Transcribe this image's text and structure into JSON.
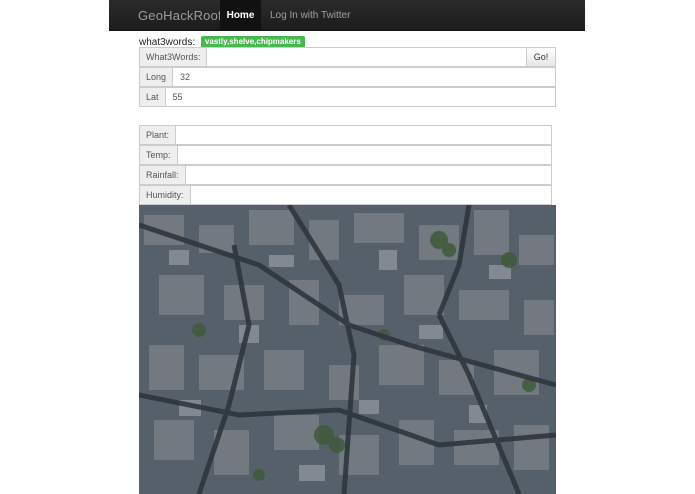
{
  "navbar": {
    "brand": "GeoHackRoofs",
    "home_label": "Home",
    "login_label": "Log In with Twitter"
  },
  "what3words": {
    "label": "what3words:",
    "badge": "vastly,shelve,chipmakers",
    "input_label": "What3Words:",
    "input_value": "",
    "go_label": "Go!"
  },
  "coords": {
    "long_label": "Long",
    "long_value": "32",
    "lat_label": "Lat",
    "lat_value": "55"
  },
  "climate": {
    "plant_label": "Plant:",
    "plant_value": "",
    "temp_label": "Temp:",
    "temp_value": "",
    "rainfall_label": "Rainfall:",
    "rainfall_value": "",
    "humidity_label": "Humidity:",
    "humidity_value": ""
  },
  "colors": {
    "navbar_bg": "#1c1c1c",
    "badge_green": "#46b84e",
    "map_base": "#4a5560"
  }
}
